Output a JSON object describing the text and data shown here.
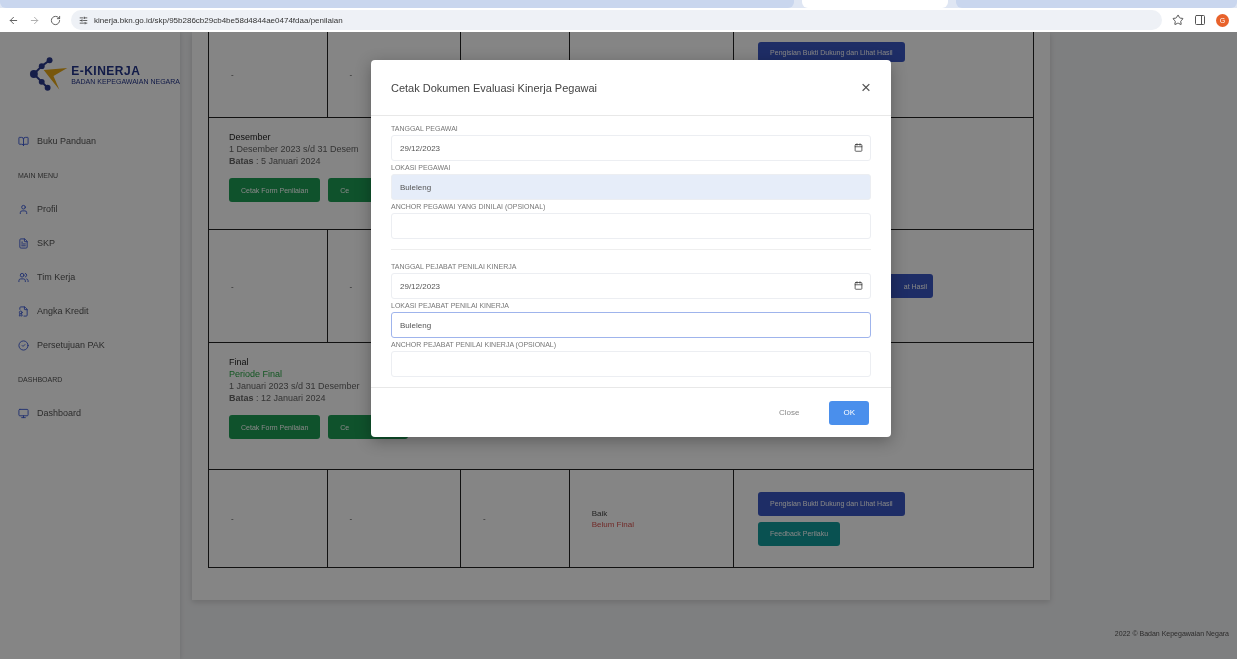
{
  "browser": {
    "url": "kinerja.bkn.go.id/skp/95b286cb29cb4be58d4844ae0474fdaa/penilaian",
    "profile_initial": "G"
  },
  "sidebar": {
    "logo": {
      "title": "E-KINERJA",
      "subtitle": "BADAN KEPEGAWAIAN NEGARA"
    },
    "items": [
      {
        "kind": "link",
        "label": "Buku Panduan"
      },
      {
        "kind": "heading",
        "label": "MAIN MENU"
      },
      {
        "kind": "link",
        "label": "Profil"
      },
      {
        "kind": "link",
        "label": "SKP"
      },
      {
        "kind": "link",
        "label": "Tim Kerja"
      },
      {
        "kind": "link",
        "label": "Angka Kredit"
      },
      {
        "kind": "link",
        "label": "Persetujuan PAK"
      },
      {
        "kind": "heading",
        "label": "DASHBOARD"
      },
      {
        "kind": "link",
        "label": "Dashboard"
      }
    ]
  },
  "table": {
    "rows": [
      {
        "kind": "cells",
        "cells": [
          {
            "text": "-"
          },
          {
            "text": "-"
          },
          {},
          {}
        ],
        "buttons": [
          {
            "label": "Pengisian Bukti Dukung dan Lihat Hasil",
            "kind": "primary"
          }
        ]
      },
      {
        "kind": "period",
        "title": "Desember",
        "periode": "",
        "range": "1 Desember 2023 s/d 31 Desem",
        "batas_label": "Batas",
        "batas": ": 5 Januari 2024",
        "buttons": [
          {
            "label": "Cetak Form Penilaian",
            "kind": "success"
          },
          {
            "label": "Ce",
            "kind": "success"
          }
        ]
      },
      {
        "kind": "cells",
        "cells": [
          {
            "text": "-"
          },
          {
            "text": "-"
          },
          {},
          {}
        ],
        "buttons": [
          {
            "label": "at Hasil",
            "kind": "primary"
          }
        ]
      },
      {
        "kind": "period",
        "title": "Final",
        "periode": "Periode Final",
        "range": "1 Januari 2023 s/d 31 Desember",
        "batas_label": "Batas",
        "batas": ": 12 Januari 2024",
        "buttons": [
          {
            "label": "Cetak Form Penilaian",
            "kind": "success"
          },
          {
            "label": "Ce",
            "kind": "success"
          }
        ]
      },
      {
        "kind": "cells",
        "cells": [
          {
            "text": "-"
          },
          {
            "text": "-"
          },
          {
            "text": "-"
          },
          {
            "text": "Baik",
            "status": "Belum Final"
          }
        ],
        "buttons": [
          {
            "label": "Pengisian Bukti Dukung dan Lihat Hasil",
            "kind": "primary"
          },
          {
            "label": "Feedback Perilaku",
            "kind": "info"
          }
        ]
      }
    ]
  },
  "footer": "2022 © Badan Kepegawaian Negara",
  "modal": {
    "title": "Cetak Dokumen Evaluasi Kinerja Pegawai",
    "close_symbol": "×",
    "sections": [
      {
        "fields": [
          {
            "label": "TANGGAL PEGAWAI",
            "kind": "date",
            "value": "29/12/2023",
            "readonly": false,
            "focused": false
          },
          {
            "label": "LOKASI PEGAWAI",
            "kind": "text",
            "value": "Buleleng",
            "readonly": true,
            "focused": false
          },
          {
            "label": "ANCHOR PEGAWAI YANG DINILAI (OPSIONAL)",
            "kind": "text",
            "readonly": false,
            "focused": false
          }
        ]
      },
      {
        "fields": [
          {
            "label": "TANGGAL PEJABAT PENILAI KINERJA",
            "kind": "date",
            "value": "29/12/2023",
            "readonly": false,
            "focused": false
          },
          {
            "label": "LOKASI PEJABAT PENILAI KINERJA",
            "kind": "text",
            "value": "Buleleng",
            "readonly": false,
            "focused": true
          },
          {
            "label": "ANCHOR PEJABAT PENILAI KINERJA (OPSIONAL)",
            "kind": "text",
            "readonly": false,
            "focused": false
          }
        ]
      }
    ],
    "buttons": [
      {
        "label": "Close",
        "kind": "secondary"
      },
      {
        "label": "OK",
        "kind": "primary"
      }
    ]
  }
}
